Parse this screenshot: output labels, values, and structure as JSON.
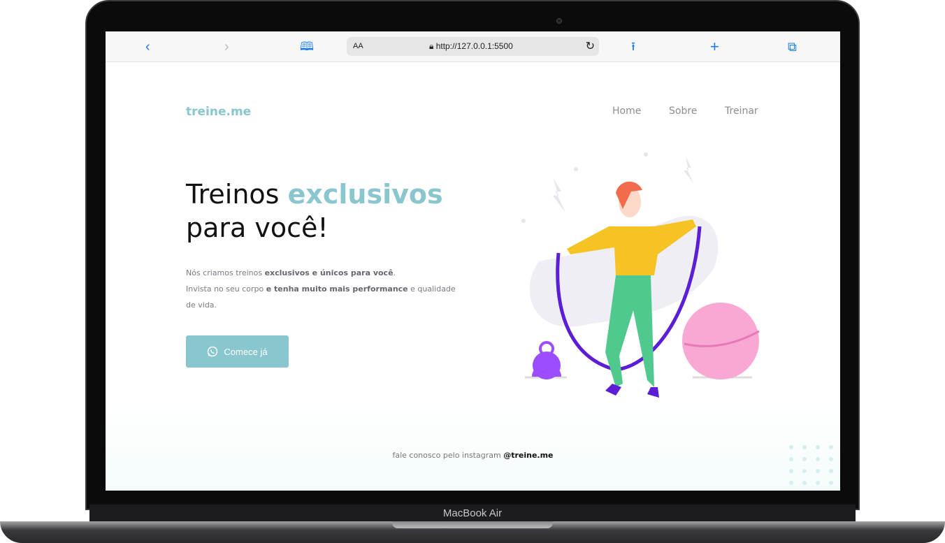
{
  "browser": {
    "url": "http://127.0.0.1:5500",
    "text_size": "AA",
    "icons": [
      "chevron-left-icon",
      "chevron-right-icon",
      "book-icon",
      "lock-icon",
      "reload-icon",
      "share-icon",
      "plus-icon",
      "tabs-icon"
    ]
  },
  "site": {
    "logo": "treine.me",
    "nav": [
      "Home",
      "Sobre",
      "Treinar"
    ]
  },
  "hero": {
    "title_1": "Treinos ",
    "title_accent": "exclusivos",
    "title_2": "para você!",
    "desc_1a": "Nós criamos treinos ",
    "desc_1b": "exclusivos e únicos para você",
    "desc_1c": ".",
    "desc_2a": "Invista no seu corpo ",
    "desc_2b": "e tenha muito mais performance",
    "desc_2c": " e qualidade de vida.",
    "cta": "Comece já"
  },
  "footer": {
    "text": "fale conosco pelo instagram ",
    "handle": "@treine.me"
  },
  "device": {
    "label": "MacBook Air"
  },
  "colors": {
    "accent": "#8ac6cd",
    "rope": "#5b1ed6",
    "ball": "#f9a8d4",
    "pants": "#4fc98e",
    "hoodie": "#f6c324"
  }
}
